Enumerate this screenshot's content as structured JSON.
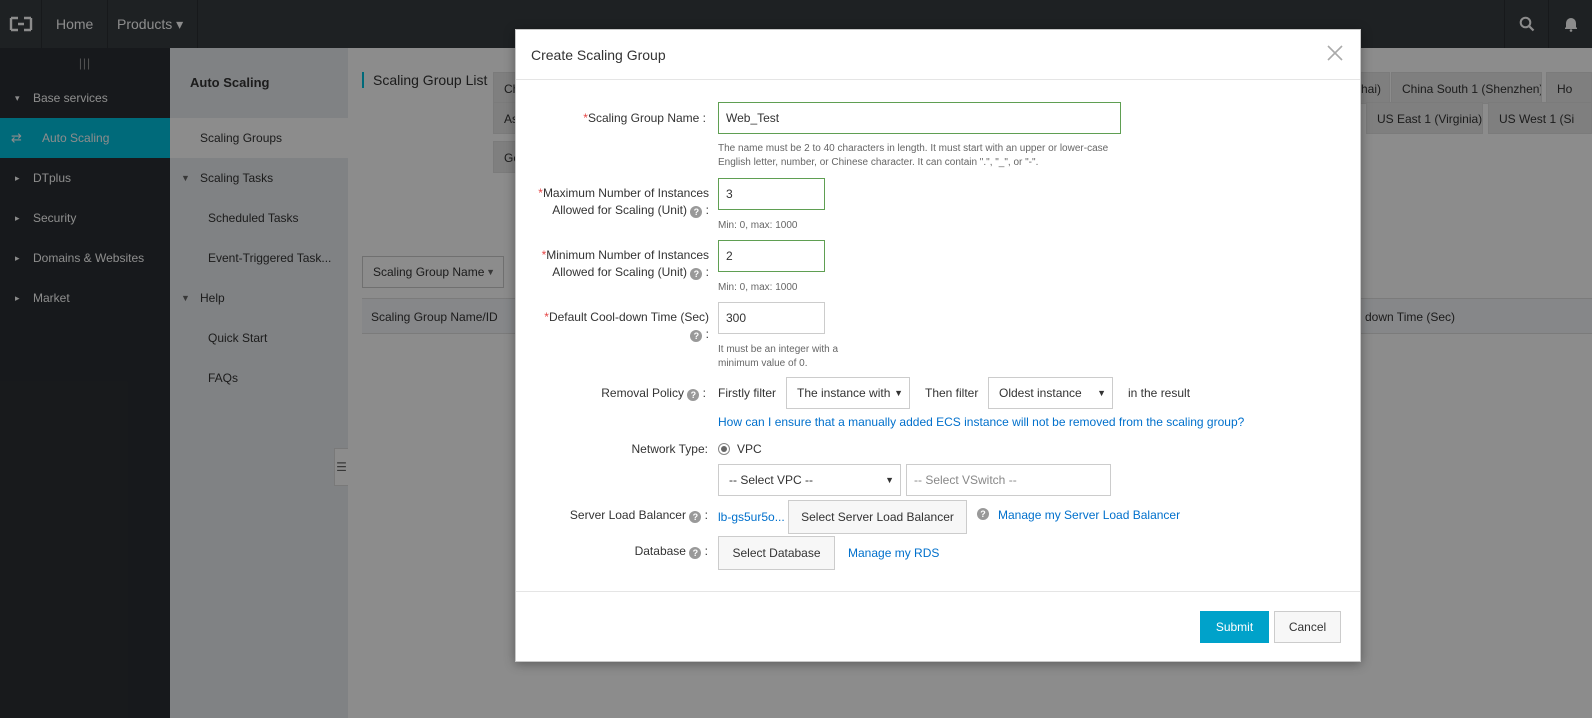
{
  "topbar": {
    "home_label": "Home",
    "products_label": "Products",
    "products_caret": "▾"
  },
  "leftnav": {
    "fold_glyph": "|||",
    "items": [
      {
        "label": "Base services",
        "caret": "▾"
      },
      {
        "label": "Auto Scaling",
        "icon": "auto-scaling-icon"
      },
      {
        "label": "DTplus",
        "caret": "▸"
      },
      {
        "label": "Security",
        "caret": "▸"
      },
      {
        "label": "Domains & Websites",
        "caret": "▸"
      },
      {
        "label": "Market",
        "caret": "▸"
      }
    ]
  },
  "subnav": {
    "title": "Auto Scaling",
    "scaling_groups": "Scaling Groups",
    "scaling_tasks": "Scaling Tasks",
    "scheduled_tasks": "Scheduled Tasks",
    "event_triggered": "Event-Triggered Task...",
    "help": "Help",
    "quick_start": "Quick Start",
    "faqs": "FAQs"
  },
  "main": {
    "list_title": "Scaling Group List",
    "regions": [
      "Ch",
      "hai)",
      "China South 1 (Shenzhen)",
      "Ho",
      "As",
      "US East 1 (Virginia)",
      "US West 1 (Si",
      "Ge"
    ],
    "search_select": "Scaling Group Name",
    "table_col1": "Scaling Group Name/ID",
    "table_col_right": "down Time (Sec)"
  },
  "modal": {
    "title": "Create Scaling Group",
    "required_mark": "*",
    "name_label": "Scaling Group Name :",
    "name_value": "Web_Test",
    "name_hint": "The name must be 2 to 40 characters in length. It must start with an upper or lower-case English letter, number, or Chinese character. It can contain \".\", \"_\", or \"-\".",
    "max_label_1": "Maximum Number of Instances",
    "max_label_2": "Allowed for Scaling (Unit)",
    "max_value": "3",
    "max_hint": "Min: 0, max: 1000",
    "min_label_1": "Minimum Number of Instances",
    "min_label_2": "Allowed for Scaling (Unit)",
    "min_value": "2",
    "min_hint": "Min: 0, max: 1000",
    "cooldown_label": "Default Cool-down Time (Sec)",
    "cooldown_value": "300",
    "cooldown_hint": "It must be an integer with a minimum value of 0.",
    "colon": ":",
    "help_glyph": "?",
    "removal_label": "Removal Policy",
    "firstly_filter": "Firstly filter",
    "first_select": "The instance with",
    "then_filter": "Then filter",
    "second_select": "Oldest instance",
    "in_result": "in the result",
    "removal_link": "How can I ensure that a manually added ECS instance will not be removed from the scaling group?",
    "network_label": "Network Type:",
    "network_option": "VPC",
    "vpc_select": "-- Select VPC --",
    "vswitch_placeholder": "-- Select VSwitch --",
    "slb_label": "Server Load Balancer",
    "slb_value": "lb-gs5ur5o...",
    "slb_button": "Select Server Load Balancer",
    "slb_manage": "Manage my Server Load Balancer",
    "db_label": "Database",
    "db_button": "Select Database",
    "db_manage": "Manage my RDS",
    "submit": "Submit",
    "cancel": "Cancel"
  },
  "colors": {
    "topbar": "#373d41",
    "leftnav": "#2b2f33",
    "active_nav": "#00c1de",
    "primary_button": "#00a2ca",
    "link": "#0070cc",
    "valid_border": "#5f9f52",
    "required": "#e54545"
  }
}
